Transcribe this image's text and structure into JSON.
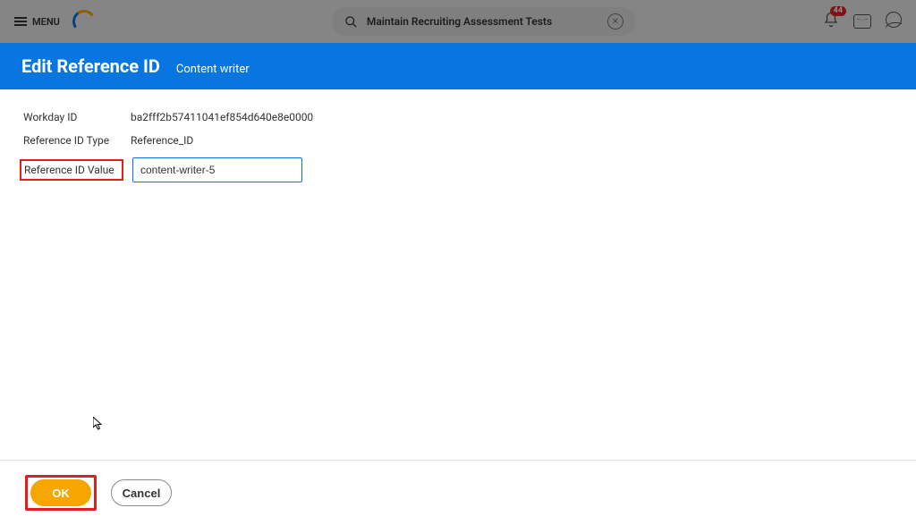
{
  "header": {
    "menu_label": "MENU",
    "search_text": "Maintain Recruiting Assessment Tests",
    "notification_count": "44"
  },
  "modal": {
    "title": "Edit Reference ID",
    "subtitle": "Content writer"
  },
  "fields": {
    "workday_id": {
      "label": "Workday ID",
      "value": "ba2fff2b57411041ef854d640e8e0000"
    },
    "ref_id_type": {
      "label": "Reference ID Type",
      "value": "Reference_ID"
    },
    "ref_id_value": {
      "label": "Reference ID Value",
      "value": "content-writer-5"
    }
  },
  "buttons": {
    "ok": "OK",
    "cancel": "Cancel"
  }
}
